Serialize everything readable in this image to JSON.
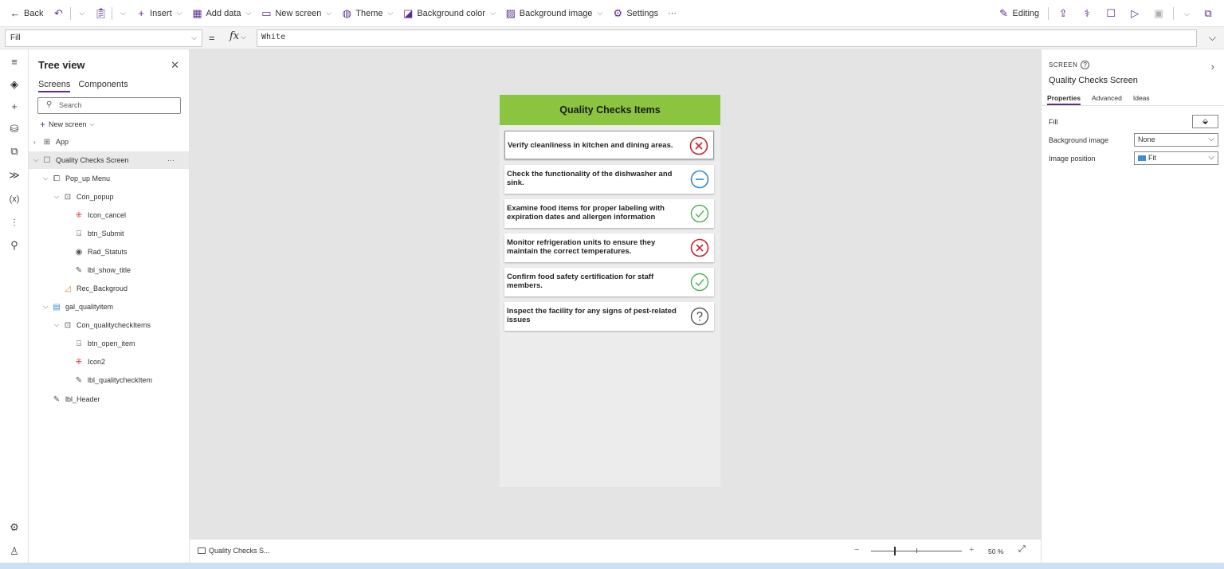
{
  "toolbar": {
    "back": "Back",
    "insert": "Insert",
    "add_data": "Add data",
    "new_screen": "New screen",
    "theme": "Theme",
    "background_color": "Background color",
    "background_image": "Background image",
    "settings": "Settings",
    "more": "···",
    "editing": "Editing"
  },
  "formula": {
    "property": "Fill",
    "equals": "=",
    "fx": "fx",
    "value": "White"
  },
  "tree": {
    "title": "Tree view",
    "tabs": [
      "Screens",
      "Components"
    ],
    "search_placeholder": "Search",
    "new_screen": "New screen",
    "nodes": [
      {
        "label": "App"
      },
      {
        "label": "Quality Checks Screen"
      },
      {
        "label": "Pop_up Menu"
      },
      {
        "label": "Con_popup"
      },
      {
        "label": "Icon_cancel"
      },
      {
        "label": "btn_Submit"
      },
      {
        "label": "Rad_Statuts"
      },
      {
        "label": "lbl_show_title"
      },
      {
        "label": "Rec_Backgroud"
      },
      {
        "label": "gal_qualityitem"
      },
      {
        "label": "Con_qualitycheckItems"
      },
      {
        "label": "btn_open_item"
      },
      {
        "label": "Icon2"
      },
      {
        "label": "lbl_qualitycheckItem"
      },
      {
        "label": "lbl_Header"
      }
    ],
    "node_more": "···"
  },
  "app": {
    "header": "Quality Checks Items",
    "items": [
      {
        "text": "Verify cleanliness in kitchen and dining areas.",
        "status": "failed",
        "icon": "cancel-circle-icon",
        "color": "#c4262e"
      },
      {
        "text": "Check the functionality of the dishwasher and sink.",
        "status": "pending",
        "icon": "minus-circle-icon",
        "color": "#2e8bc0"
      },
      {
        "text": "Examine food items for proper labeling with expiration dates and allergen information",
        "status": "passed",
        "icon": "check-circle-icon",
        "color": "#4caf50"
      },
      {
        "text": "Monitor refrigeration units to ensure they maintain the correct temperatures.",
        "status": "failed",
        "icon": "cancel-circle-icon",
        "color": "#c4262e"
      },
      {
        "text": "Confirm food safety certification for staff members.",
        "status": "passed",
        "icon": "check-circle-icon",
        "color": "#4caf50"
      },
      {
        "text": "Inspect the facility for any signs of pest-related issues",
        "status": "unknown",
        "icon": "question-circle-icon",
        "color": "#555555"
      }
    ]
  },
  "status": {
    "screen_tab": "Quality Checks S...",
    "zoom": "50 %",
    "zoom_fraction": 0.25
  },
  "props": {
    "kind": "SCREEN",
    "name": "Quality Checks Screen",
    "tabs": [
      "Properties",
      "Advanced",
      "Ideas"
    ],
    "fill_label": "Fill",
    "bg_image_label": "Background image",
    "bg_image_value": "None",
    "img_pos_label": "Image position",
    "img_pos_value": "Fit"
  },
  "colors": {
    "accent": "#5c2d91",
    "header_green": "#8bc53f"
  }
}
